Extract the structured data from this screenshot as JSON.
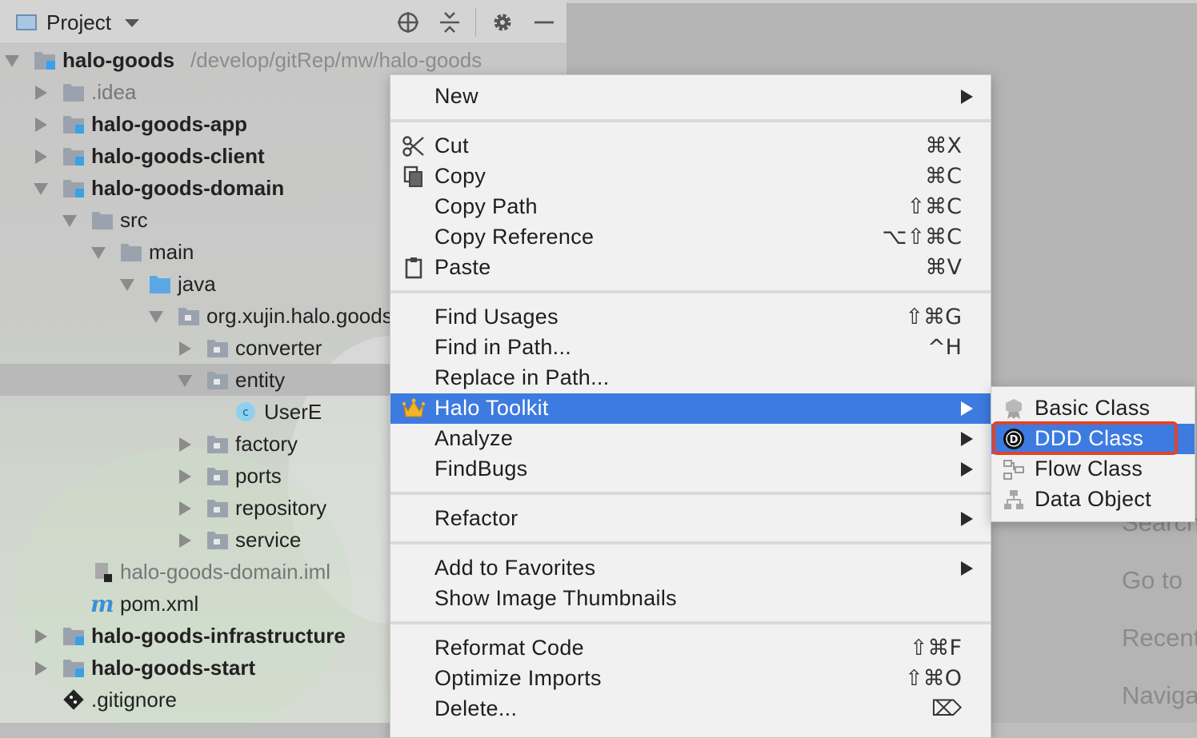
{
  "toolbar": {
    "title": "Project",
    "icons": [
      "locate-icon",
      "collapse-all-icon",
      "gear-icon",
      "minimize-icon"
    ]
  },
  "tree": {
    "root_name": "halo-goods",
    "root_path": "/develop/gitRep/mw/halo-goods",
    "items": [
      {
        "label": "halo-goods"
      },
      {
        "label": ".idea"
      },
      {
        "label": "halo-goods-app"
      },
      {
        "label": "halo-goods-client"
      },
      {
        "label": "halo-goods-domain"
      },
      {
        "label": "src"
      },
      {
        "label": "main"
      },
      {
        "label": "java"
      },
      {
        "label": "org.xujin.halo.goods"
      },
      {
        "label": "converter"
      },
      {
        "label": "entity"
      },
      {
        "label": "UserE"
      },
      {
        "label": "factory"
      },
      {
        "label": "ports"
      },
      {
        "label": "repository"
      },
      {
        "label": "service"
      },
      {
        "label": "halo-goods-domain.iml"
      },
      {
        "label": "pom.xml"
      },
      {
        "label": "halo-goods-infrastructure"
      },
      {
        "label": "halo-goods-start"
      },
      {
        "label": ".gitignore"
      }
    ]
  },
  "menu": {
    "items": [
      {
        "label": "New",
        "shortcut": ""
      },
      {
        "label": "Cut",
        "shortcut": "⌘X"
      },
      {
        "label": "Copy",
        "shortcut": "⌘C"
      },
      {
        "label": "Copy Path",
        "shortcut": "⇧⌘C"
      },
      {
        "label": "Copy Reference",
        "shortcut": "⌥⇧⌘C"
      },
      {
        "label": "Paste",
        "shortcut": "⌘V"
      },
      {
        "label": "Find Usages",
        "shortcut": "⇧⌘G"
      },
      {
        "label": "Find in Path...",
        "shortcut": "^H"
      },
      {
        "label": "Replace in Path...",
        "shortcut": ""
      },
      {
        "label": "Halo Toolkit",
        "shortcut": ""
      },
      {
        "label": "Analyze",
        "shortcut": ""
      },
      {
        "label": "FindBugs",
        "shortcut": ""
      },
      {
        "label": "Refactor",
        "shortcut": ""
      },
      {
        "label": "Add to Favorites",
        "shortcut": ""
      },
      {
        "label": "Show Image Thumbnails",
        "shortcut": ""
      },
      {
        "label": "Reformat Code",
        "shortcut": "⇧⌘F"
      },
      {
        "label": "Optimize Imports",
        "shortcut": "⇧⌘O"
      },
      {
        "label": "Delete...",
        "shortcut": "⌦"
      }
    ]
  },
  "submenu": {
    "items": [
      {
        "label": "Basic Class"
      },
      {
        "label": "DDD Class"
      },
      {
        "label": "Flow Class"
      },
      {
        "label": "Data Object"
      }
    ]
  },
  "editor_hints": [
    "Search",
    "Go to",
    "Recent",
    "Naviga"
  ],
  "colors": {
    "selection": "#3d7be0",
    "highlight_box": "#e0432a",
    "module_icon": "#3aa0e8"
  }
}
